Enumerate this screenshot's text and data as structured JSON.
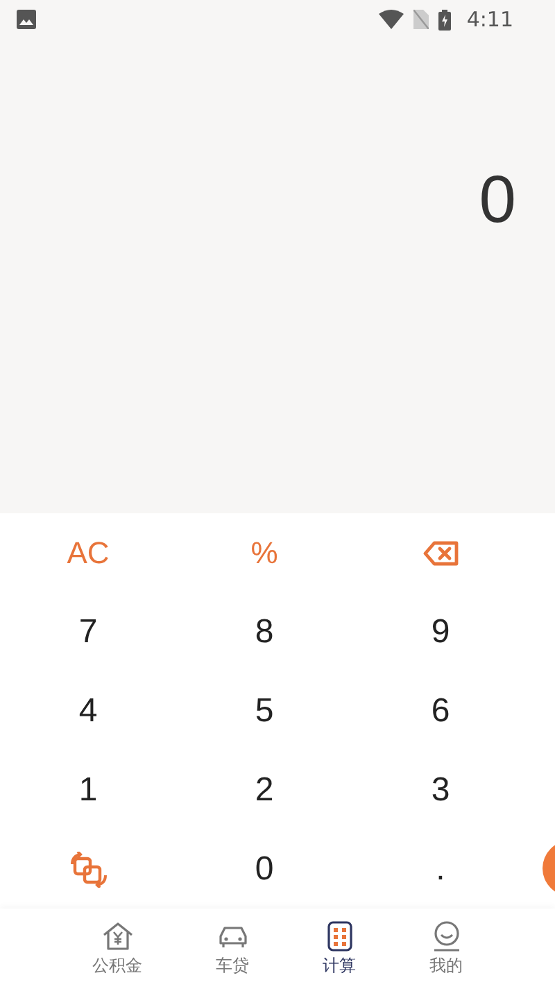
{
  "status_bar": {
    "time": "4:11"
  },
  "display": {
    "value": "0"
  },
  "keys": [
    {
      "kind": "function",
      "label": "AC"
    },
    {
      "kind": "function",
      "label": "%"
    },
    {
      "kind": "backspace"
    },
    {
      "kind": "digit",
      "label": "7"
    },
    {
      "kind": "digit",
      "label": "8"
    },
    {
      "kind": "digit",
      "label": "9"
    },
    {
      "kind": "digit",
      "label": "4"
    },
    {
      "kind": "digit",
      "label": "5"
    },
    {
      "kind": "digit",
      "label": "6"
    },
    {
      "kind": "digit",
      "label": "1"
    },
    {
      "kind": "digit",
      "label": "2"
    },
    {
      "kind": "digit",
      "label": "3"
    },
    {
      "kind": "switch"
    },
    {
      "kind": "digit",
      "label": "0"
    },
    {
      "kind": "digit",
      "label": "."
    }
  ],
  "bottom_nav": [
    {
      "kind": "house",
      "label": "公积金",
      "selected": false
    },
    {
      "kind": "car",
      "label": "车贷",
      "selected": false
    },
    {
      "kind": "calculator",
      "label": "计算",
      "selected": true
    },
    {
      "kind": "smile",
      "label": "我的",
      "selected": false
    }
  ]
}
